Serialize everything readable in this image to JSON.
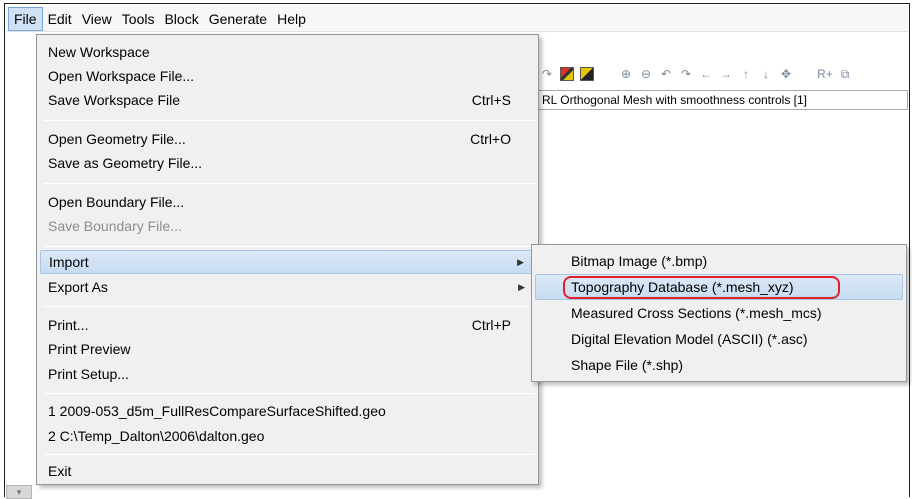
{
  "menubar": {
    "items": [
      "File",
      "Edit",
      "View",
      "Tools",
      "Block",
      "Generate",
      "Help"
    ],
    "active_index": 0
  },
  "toolbar": {
    "icons": [
      "redo-icon",
      "copy-colored-icon",
      "paste-colored-icon",
      "zoom-in-icon",
      "zoom-out-icon",
      "undo-view-icon",
      "redo-view-icon",
      "pan-left-icon",
      "pan-right-icon",
      "pan-up-icon",
      "pan-down-icon",
      "move-icon",
      "refine-icon",
      "grid-icon"
    ],
    "glyphs": [
      "↷",
      "",
      "",
      "⊕",
      "⊖",
      "↶",
      "↷",
      "←",
      "→",
      "↑",
      "↓",
      "✥",
      "R+",
      "⧉"
    ]
  },
  "mesh_selector": {
    "value": "RL Orthogonal Mesh with smoothness controls [1]"
  },
  "file_menu": {
    "items": [
      {
        "label": "New Workspace",
        "shortcut": "",
        "disabled": false,
        "submenu": false
      },
      {
        "label": "Open Workspace File...",
        "shortcut": "",
        "disabled": false,
        "submenu": false
      },
      {
        "label": "Save Workspace File",
        "shortcut": "Ctrl+S",
        "disabled": false,
        "submenu": false
      },
      {
        "label": "Open Geometry File...",
        "shortcut": "Ctrl+O",
        "disabled": false,
        "submenu": false
      },
      {
        "label": "Save as Geometry File...",
        "shortcut": "",
        "disabled": false,
        "submenu": false
      },
      {
        "label": "Open Boundary File...",
        "shortcut": "",
        "disabled": false,
        "submenu": false
      },
      {
        "label": "Save Boundary File...",
        "shortcut": "",
        "disabled": true,
        "submenu": false
      },
      {
        "label": "Import",
        "shortcut": "",
        "disabled": false,
        "submenu": true,
        "highlighted": true
      },
      {
        "label": "Export As",
        "shortcut": "",
        "disabled": false,
        "submenu": true
      },
      {
        "label": "Print...",
        "shortcut": "Ctrl+P",
        "disabled": false,
        "submenu": false
      },
      {
        "label": "Print Preview",
        "shortcut": "",
        "disabled": false,
        "submenu": false
      },
      {
        "label": "Print Setup...",
        "shortcut": "",
        "disabled": false,
        "submenu": false
      },
      {
        "label": "1 2009-053_d5m_FullResCompareSurfaceShifted.geo",
        "shortcut": "",
        "disabled": false,
        "submenu": false
      },
      {
        "label": "2 C:\\Temp_Dalton\\2006\\dalton.geo",
        "shortcut": "",
        "disabled": false,
        "submenu": false
      },
      {
        "label": "Exit",
        "shortcut": "",
        "disabled": false,
        "submenu": false
      }
    ]
  },
  "import_submenu": {
    "items": [
      {
        "label": "Bitmap Image (*.bmp)"
      },
      {
        "label": "Topography Database (*.mesh_xyz)",
        "highlighted": true,
        "circled": true
      },
      {
        "label": "Measured Cross Sections (*.mesh_mcs)"
      },
      {
        "label": "Digital Elevation Model (ASCII) (*.asc)"
      },
      {
        "label": "Shape File (*.shp)"
      }
    ]
  },
  "colors": {
    "highlight": "#c7dcf2",
    "annotation_circle": "#e0202a",
    "menu_bg": "#f0f0f0"
  }
}
